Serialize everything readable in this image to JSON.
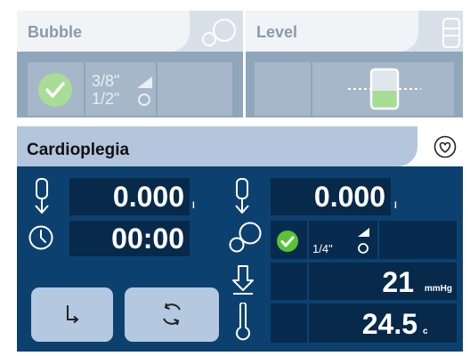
{
  "bubble_panel": {
    "title": "Bubble",
    "tube_size_top": "3/8\"",
    "tube_size_bottom": "1/2\"",
    "icon": "bubbles-icon",
    "status_icon": "check-icon"
  },
  "level_panel": {
    "title": "Level",
    "icon": "reservoir-icon"
  },
  "cardioplegia": {
    "title": "Cardioplegia",
    "header_icon": "heart-icon",
    "volume_left": {
      "value": "0.000",
      "unit": "l"
    },
    "volume_right": {
      "value": "0.000",
      "unit": "l"
    },
    "timer": "00:00",
    "bubble_tube_size": "1/4\"",
    "pressure": {
      "value": "21",
      "unit": "mmHg"
    },
    "temperature": {
      "value": "24.5",
      "unit": "c"
    },
    "buttons": {
      "left_icon": "flow-direction-icon",
      "right_icon": "cycle-icon"
    }
  },
  "colors": {
    "main_panel": "#0c416f",
    "value_box": "#07294a",
    "inactive_panel": "#8fa6bb",
    "check_green": "#5bc236"
  }
}
